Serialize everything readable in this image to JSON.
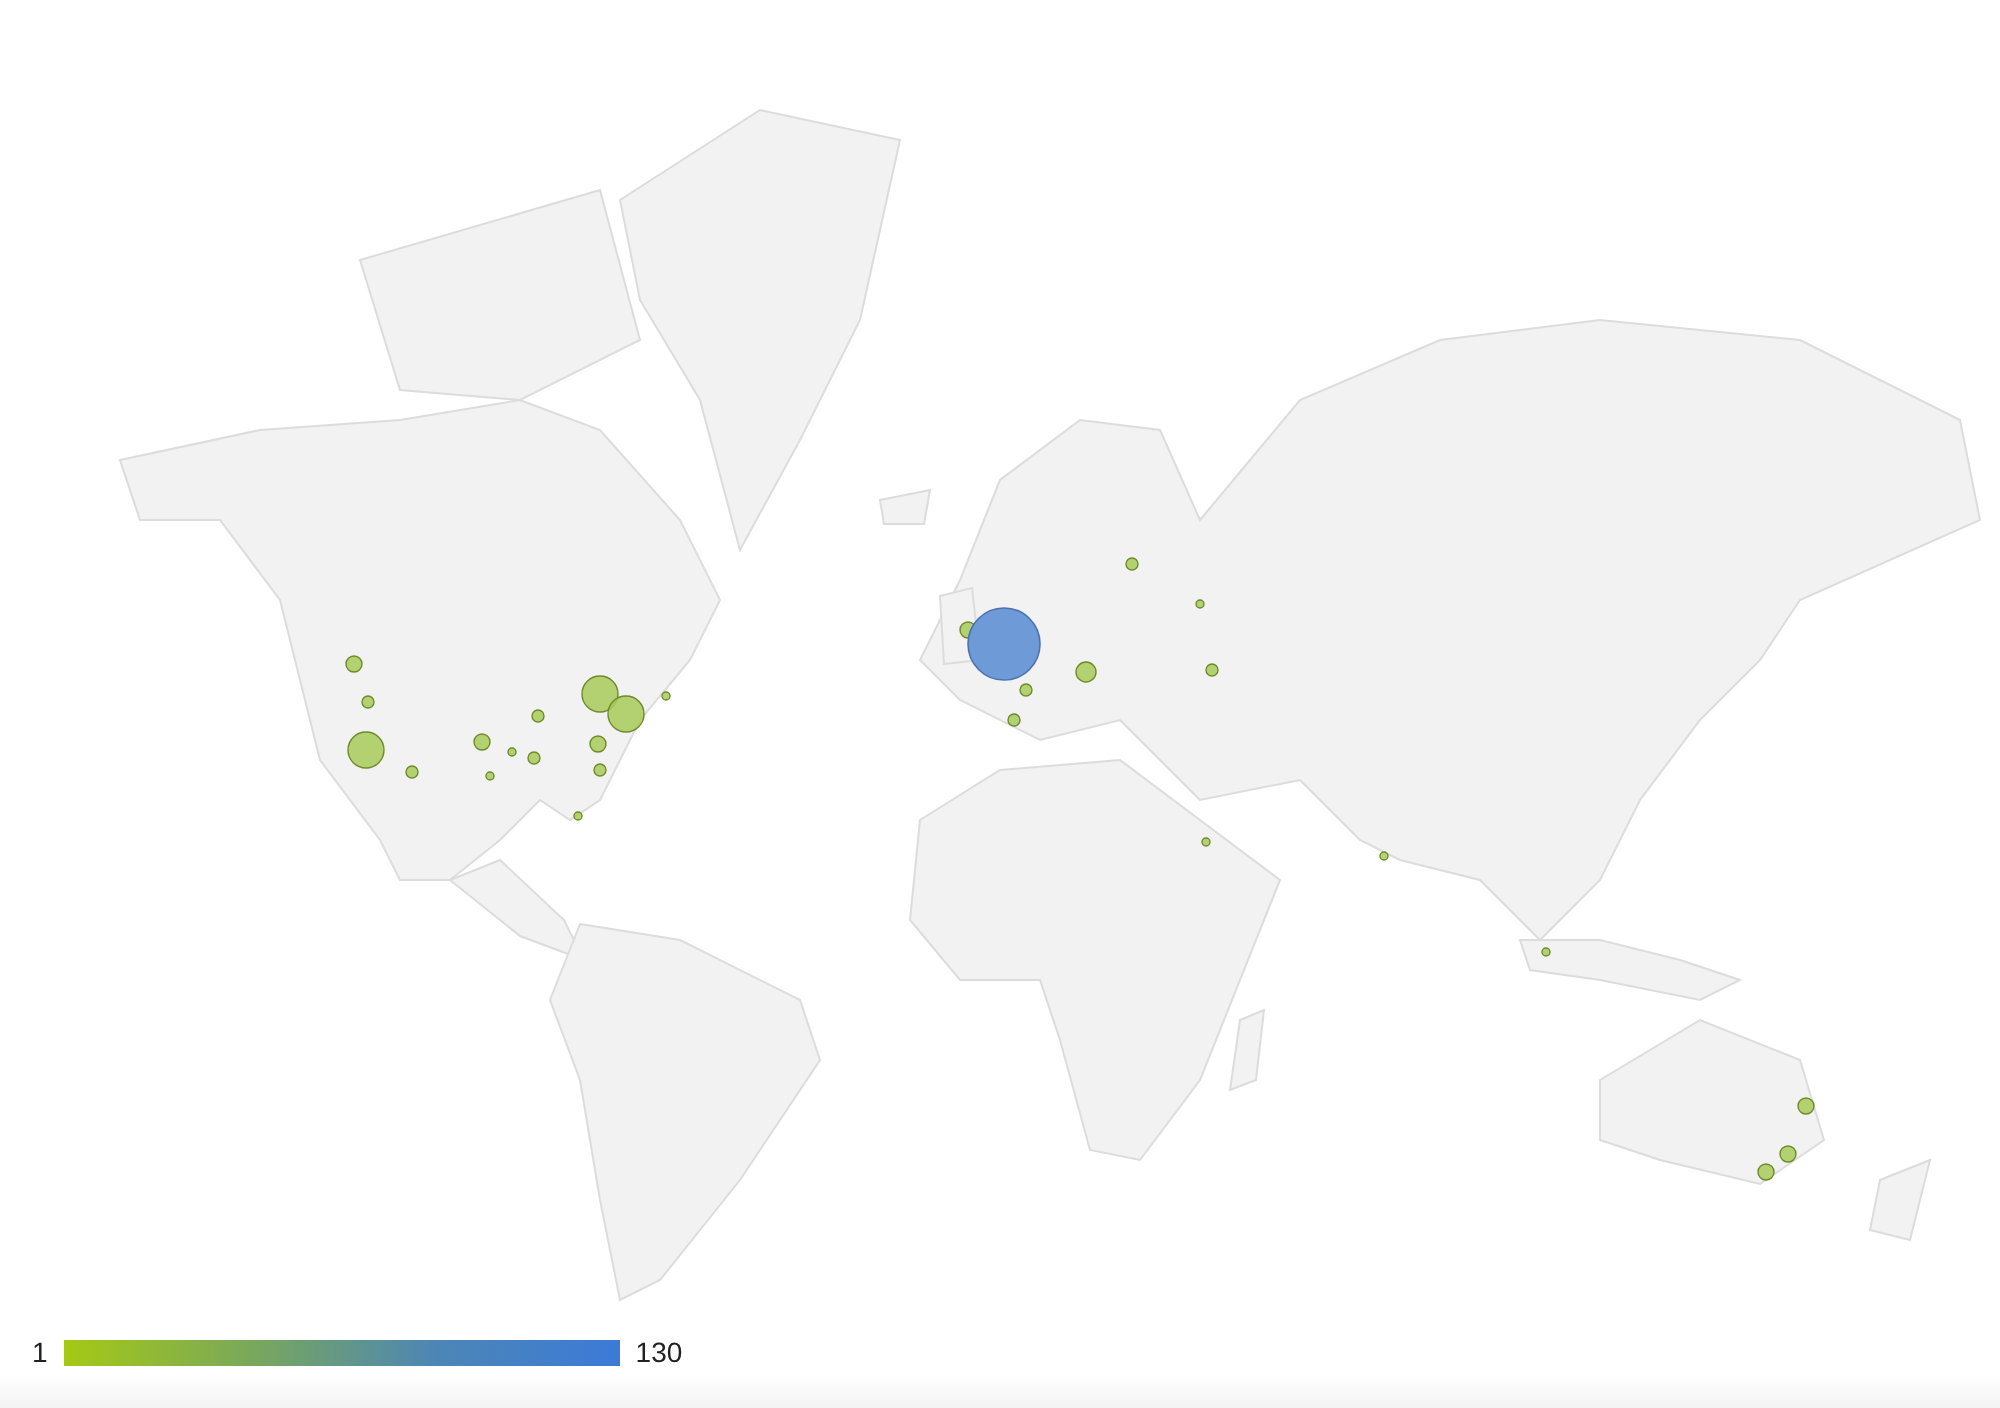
{
  "legend": {
    "min_label": "1",
    "max_label": "130"
  }
}
